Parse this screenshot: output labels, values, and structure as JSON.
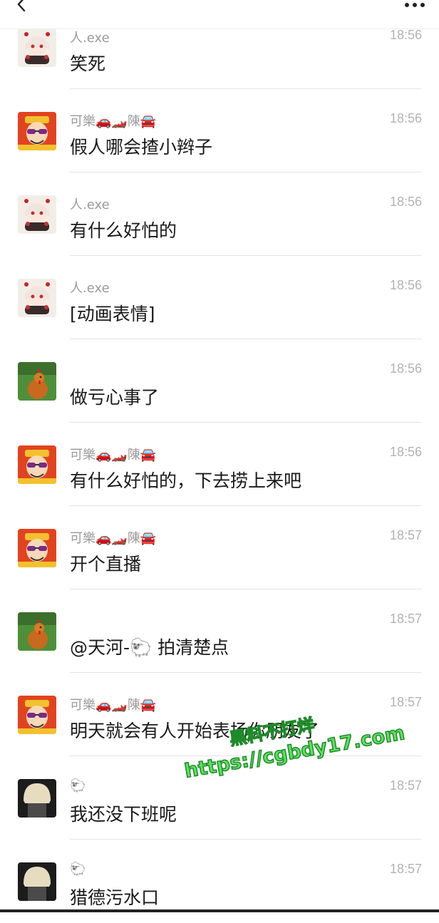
{
  "header": {
    "back_icon": "chevron-left-icon",
    "more_icon": "more-dots-icon"
  },
  "messages": [
    {
      "avatar": "anime-girl-avatar",
      "name": "人.exe",
      "time": "18:56",
      "text": "笑死"
    },
    {
      "avatar": "cartoon-god-avatar",
      "name": "可樂🚗🏎️陳🚘",
      "time": "18:56",
      "text": "假人哪会揸小辫子"
    },
    {
      "avatar": "anime-girl-avatar",
      "name": "人.exe",
      "time": "18:56",
      "text": "有什么好怕的"
    },
    {
      "avatar": "anime-girl-avatar",
      "name": "人.exe",
      "time": "18:56",
      "text": "[动画表情]"
    },
    {
      "avatar": "rooster-avatar",
      "name": "",
      "time": "18:56",
      "text": "做亏心事了"
    },
    {
      "avatar": "cartoon-god-avatar",
      "name": "可樂🚗🏎️陳🚘",
      "time": "18:56",
      "text": "有什么好怕的，下去捞上来吧"
    },
    {
      "avatar": "cartoon-god-avatar",
      "name": "可樂🚗🏎️陳🚘",
      "time": "18:57",
      "text": "开个直播"
    },
    {
      "avatar": "rooster-avatar",
      "name": "",
      "time": "18:57",
      "text": "@天河-🐑 拍清楚点"
    },
    {
      "avatar": "cartoon-god-avatar",
      "name": "可樂🚗🏎️陳🚘",
      "time": "18:57",
      "text": "明天就会有人开始表扬你朋友了"
    },
    {
      "avatar": "blonde-person-avatar",
      "name": "🐑",
      "time": "18:57",
      "text": "我还没下班呢"
    },
    {
      "avatar": "blonde-person-avatar",
      "name": "🐑",
      "time": "18:57",
      "text": "猎德污水口"
    }
  ],
  "watermark": {
    "line1": "黑料不打烊",
    "line2": "https://cgbdy17.com"
  },
  "colors": {
    "name": "#9a9a9a",
    "time": "#b3b3b3",
    "message": "#1a1a1a",
    "watermark": "#5fe05f"
  }
}
